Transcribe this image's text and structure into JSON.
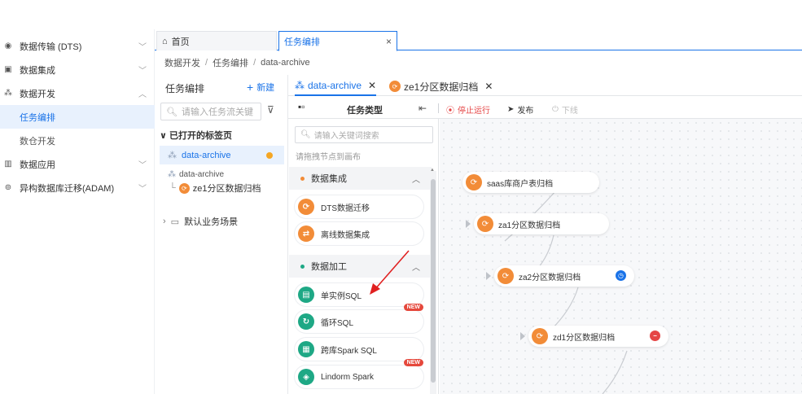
{
  "nav": {
    "items": [
      {
        "label": "数据传输 (DTS)",
        "icon": "dts-icon",
        "chevron": "﹀"
      },
      {
        "label": "数据集成",
        "icon": "integration-icon",
        "chevron": "﹀"
      },
      {
        "label": "数据开发",
        "icon": "develop-icon",
        "chevron": "︿"
      },
      {
        "label": "数据应用",
        "icon": "application-icon",
        "chevron": "﹀"
      },
      {
        "label": "异构数据库迁移(ADAM)",
        "icon": "adam-icon",
        "chevron": "﹀"
      }
    ],
    "sub_items": [
      {
        "label": "任务编排",
        "active": true
      },
      {
        "label": "数仓开发",
        "active": false
      }
    ]
  },
  "page_tabs": {
    "home": "首页",
    "active": "任务编排",
    "close": "×"
  },
  "breadcrumb": [
    "数据开发",
    "任务编排",
    "data-archive"
  ],
  "breadcrumb_sep": "/",
  "task_panel": {
    "title": "任务编排",
    "new_label": "新建",
    "search_placeholder": "请输入任务流关键",
    "opened_header": "已打开的标签页",
    "opened_item": "data-archive",
    "tree_parent": "data-archive",
    "tree_child": "ze1分区数据归档",
    "scene": "默认业务场景"
  },
  "editor_tabs": [
    {
      "label": "data-archive",
      "active": true
    },
    {
      "label": "ze1分区数据归档",
      "active": false
    }
  ],
  "toolbar": {
    "task_type": "任务类型",
    "stop": "停止运行",
    "publish": "发布",
    "offline": "下线"
  },
  "library": {
    "search_placeholder": "请输入关键词搜索",
    "hint": "请拖拽节点到画布",
    "categories": [
      {
        "label": "数据集成",
        "color": "#f28c38"
      },
      {
        "label": "数据加工",
        "color": "#1ea885"
      }
    ],
    "integration_nodes": [
      {
        "label": "DTS数据迁移",
        "glyph": "⟳"
      },
      {
        "label": "离线数据集成",
        "glyph": "⇄"
      }
    ],
    "processing_nodes": [
      {
        "label": "单实例SQL",
        "glyph": "▤",
        "badge": ""
      },
      {
        "label": "循环SQL",
        "glyph": "↻",
        "badge": "NEW"
      },
      {
        "label": "跨库Spark SQL",
        "glyph": "▦",
        "badge": ""
      },
      {
        "label": "Lindorm Spark",
        "glyph": "◈",
        "badge": "NEW"
      }
    ],
    "scroll_marker": "▲"
  },
  "canvas_nodes": [
    {
      "label": "saas库商户表归档",
      "status": ""
    },
    {
      "label": "za1分区数据归档",
      "status": ""
    },
    {
      "label": "za2分区数据归档",
      "status": "clock"
    },
    {
      "label": "zd1分区数据归档",
      "status": "minus"
    }
  ],
  "colors": {
    "accent": "#1a73e8",
    "danger": "#e54545",
    "orange": "#f28c38",
    "green": "#1ea885",
    "arrow": "#e02020"
  }
}
